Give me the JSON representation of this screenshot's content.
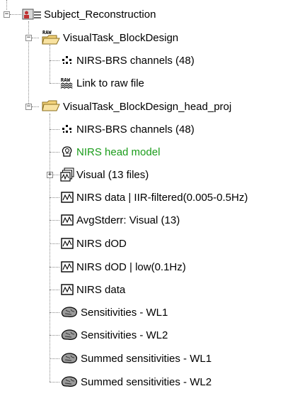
{
  "tree": {
    "root": {
      "label": "Subject_Reconstruction",
      "icon": "subject-icon",
      "expander": "−"
    },
    "cond1": {
      "label": "VisualTask_BlockDesign",
      "icon": "raw-folder-icon",
      "expander": "−",
      "items": [
        {
          "label": "NIRS-BRS channels (48)",
          "icon": "channels-icon"
        },
        {
          "label": "Link to raw file",
          "icon": "raw-link-icon"
        }
      ]
    },
    "cond2": {
      "label": "VisualTask_BlockDesign_head_proj",
      "icon": "folder-open-icon",
      "expander": "−",
      "items": [
        {
          "label": "NIRS-BRS channels (48)",
          "icon": "channels-icon"
        },
        {
          "label": "NIRS head model",
          "icon": "head-model-icon",
          "color": "#1a9c1a"
        },
        {
          "label": "Visual (13 files)",
          "icon": "data-list-icon",
          "expander": "+"
        },
        {
          "label": "NIRS data | IIR-filtered(0.005-0.5Hz)",
          "icon": "data-icon"
        },
        {
          "label": "AvgStderr: Visual (13)",
          "icon": "data-icon"
        },
        {
          "label": "NIRS dOD",
          "icon": "data-icon"
        },
        {
          "label": "NIRS dOD | low(0.1Hz)",
          "icon": "data-icon"
        },
        {
          "label": "NIRS data",
          "icon": "data-icon"
        },
        {
          "label": "Sensitivities - WL1",
          "icon": "brain-icon"
        },
        {
          "label": "Sensitivities - WL2",
          "icon": "brain-icon"
        },
        {
          "label": "Summed sensitivities - WL1",
          "icon": "brain-icon"
        },
        {
          "label": "Summed sensitivities - WL2",
          "icon": "brain-icon"
        }
      ]
    }
  }
}
